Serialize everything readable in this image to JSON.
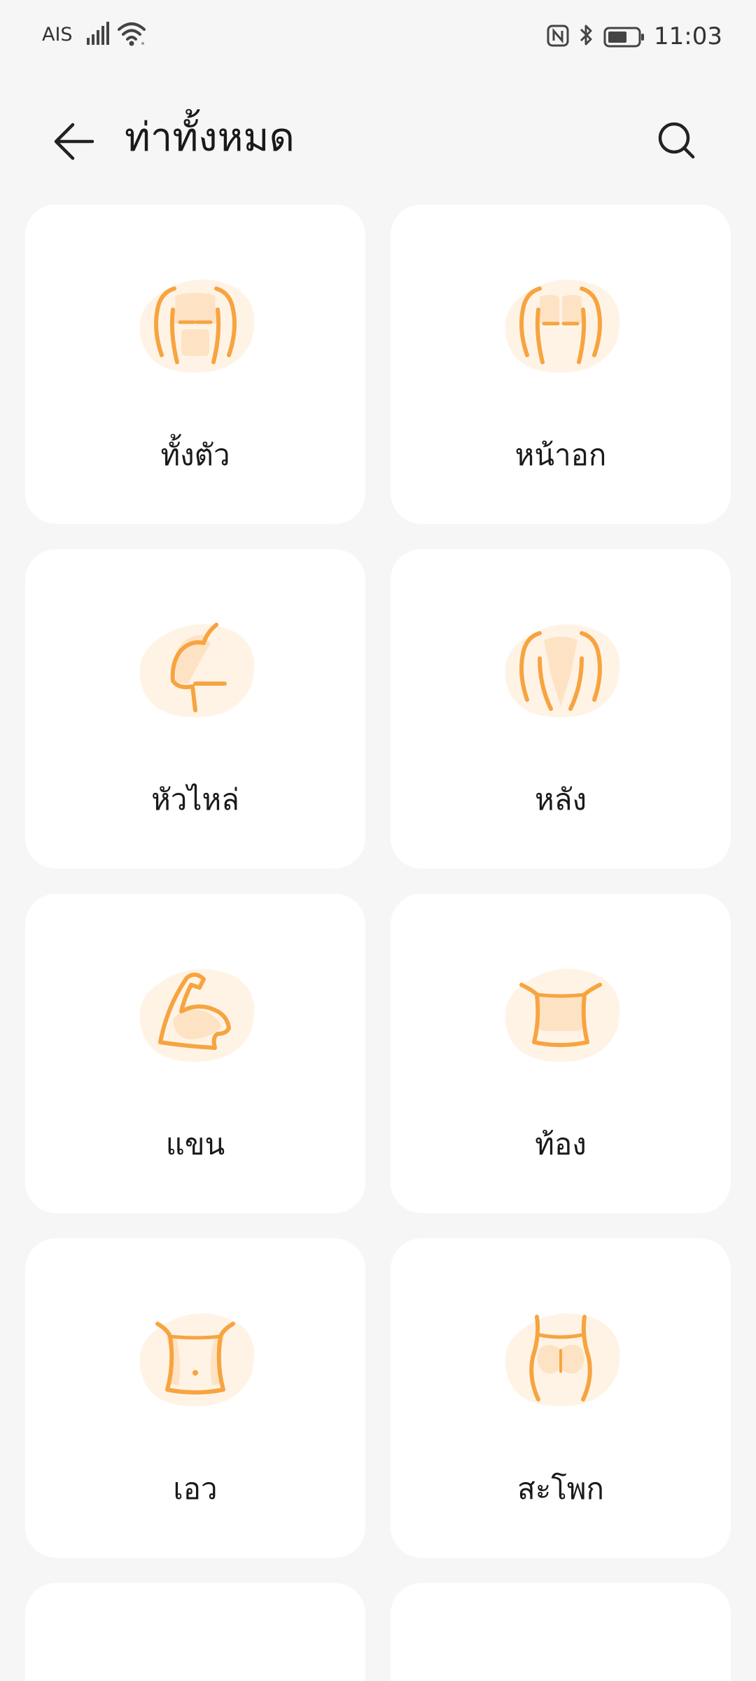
{
  "status_bar": {
    "carrier": "AIS",
    "time": "11:03",
    "icons": [
      "signal-icon",
      "wifi-icon",
      "nfc-icon",
      "bluetooth-icon",
      "battery-icon"
    ]
  },
  "header": {
    "title": "ท่าทั้งหมด",
    "back_icon": "arrow-left-icon",
    "search_icon": "search-icon"
  },
  "categories": [
    {
      "label": "ทั้งตัว",
      "icon": "full-body-icon"
    },
    {
      "label": "หน้าอก",
      "icon": "chest-icon"
    },
    {
      "label": "หัวไหล่",
      "icon": "shoulder-icon"
    },
    {
      "label": "หลัง",
      "icon": "back-muscle-icon"
    },
    {
      "label": "แขน",
      "icon": "arm-icon"
    },
    {
      "label": "ท้อง",
      "icon": "abs-icon"
    },
    {
      "label": "เอว",
      "icon": "waist-icon"
    },
    {
      "label": "สะโพก",
      "icon": "hip-icon"
    }
  ],
  "colors": {
    "accent": "#f7a440",
    "accent_light": "#fde3c4",
    "blob": "#fff3e6",
    "background": "#f6f6f6",
    "card": "#ffffff"
  }
}
